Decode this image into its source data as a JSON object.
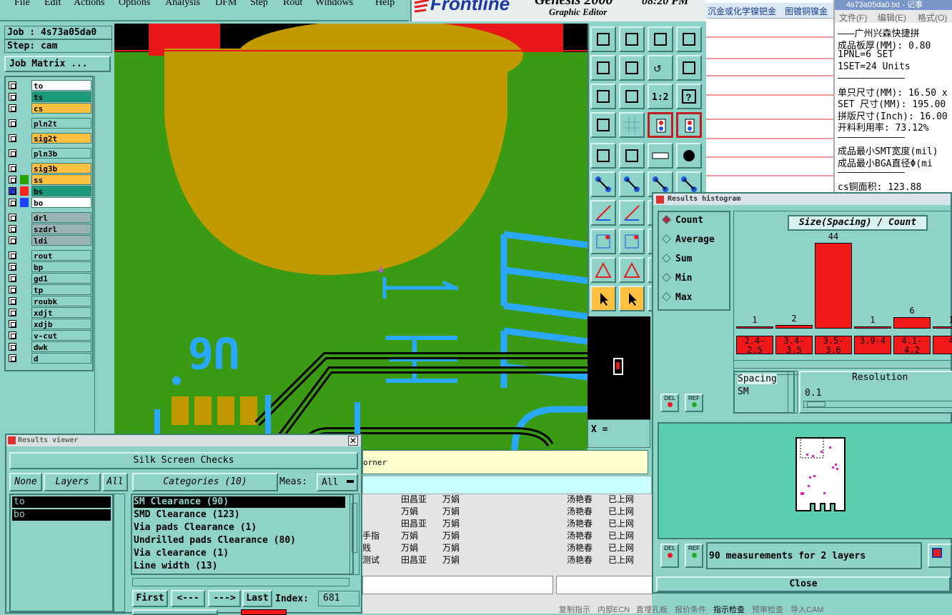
{
  "menubar": {
    "file": "File",
    "edit": "Edit",
    "actions": "Actions",
    "options": "Options",
    "analysis": "Analysis",
    "dfm": "DFM",
    "step": "Step",
    "rout": "Rout",
    "windows": "Windows",
    "help": "Help"
  },
  "logo": {
    "brand": "Frontline",
    "product": "Genesis 2000",
    "subtitle": "Graphic Editor",
    "time": "08:20 PM"
  },
  "job": {
    "job": "Job : 4s73a05da0",
    "step": "Step: cam",
    "matrix_btn": "Job Matrix ..."
  },
  "layers": [
    {
      "name": "to",
      "color": "#ffffff",
      "sw": ""
    },
    {
      "name": "ts",
      "color": "#1a9a7a",
      "sw": ""
    },
    {
      "name": "cs",
      "color": "#ffc040",
      "sw": ""
    },
    {
      "name": "pln2t",
      "color": "#8fd3c8",
      "sw": ""
    },
    {
      "name": "sig2t",
      "color": "#ffc040",
      "sw": ""
    },
    {
      "name": "pln3b",
      "color": "#8fd3c8",
      "sw": ""
    },
    {
      "name": "sig3b",
      "color": "#ffc040",
      "sw": ""
    },
    {
      "name": "ss",
      "color": "#ffc040",
      "sw": "#2aa000"
    },
    {
      "name": "bs",
      "color": "#1a9a7a",
      "sw": "#ff2020"
    },
    {
      "name": "bo",
      "color": "#ffffff",
      "sw": "#2040ff"
    },
    {
      "name": "drl",
      "color": "#9ab4b4",
      "sw": ""
    },
    {
      "name": "szdrl",
      "color": "#9ab4b4",
      "sw": ""
    },
    {
      "name": "ldi",
      "color": "#9ab4b4",
      "sw": ""
    },
    {
      "name": "rout",
      "color": "#8fd3c8",
      "sw": ""
    },
    {
      "name": "bp",
      "color": "#8fd3c8",
      "sw": ""
    },
    {
      "name": "gd1",
      "color": "#8fd3c8",
      "sw": ""
    },
    {
      "name": "tp",
      "color": "#8fd3c8",
      "sw": ""
    },
    {
      "name": "roubk",
      "color": "#8fd3c8",
      "sw": ""
    },
    {
      "name": "xdjt",
      "color": "#8fd3c8",
      "sw": ""
    },
    {
      "name": "xdjb",
      "color": "#8fd3c8",
      "sw": ""
    },
    {
      "name": "v-cut",
      "color": "#8fd3c8",
      "sw": ""
    },
    {
      "name": "dwk",
      "color": "#8fd3c8",
      "sw": ""
    },
    {
      "name": "d",
      "color": "#8fd3c8",
      "sw": ""
    }
  ],
  "pcb": {
    "silk_text": "U6"
  },
  "status": {
    "x_label": "X =",
    "msg": "orner"
  },
  "results_viewer": {
    "title": "Results viewer",
    "header": "Silk Screen Checks",
    "none": "None",
    "layers": "Layers",
    "all": "All",
    "categories": "Categories (10)",
    "meas_label": "Meas:",
    "meas_value": "All",
    "layer_list": [
      "to",
      "bo"
    ],
    "checks": [
      "SM Clearance (90)",
      "SMD Clearance (123)",
      "Via pads Clearance (1)",
      "Undrilled pads Clearance (80)",
      "Via clearance (1)",
      "Line width (13)"
    ],
    "first": "First",
    "prev": "<---",
    "next": "--->",
    "last": "Last",
    "index_label": "Index:",
    "index_value": "681"
  },
  "histogram": {
    "title": "Results histogram",
    "modes": [
      "Count",
      "Average",
      "Sum",
      "Min",
      "Max"
    ],
    "chart_title": "Size(Spacing) / Count",
    "spacing_label": "Spacing",
    "sm_label": "SM",
    "resolution_label": "Resolution",
    "resolution_value": "0.1",
    "del": "DEL",
    "ref": "REF",
    "summary": "90 measurements for 2 layers",
    "close": "Close"
  },
  "chart_data": {
    "type": "bar",
    "title": "Size(Spacing) / Count",
    "categories": [
      "2.4-2.5",
      "3.4-3.5",
      "3.5-3.6",
      "3.9-4",
      "4.1-4.2",
      "4"
    ],
    "values": [
      1,
      2,
      44,
      1,
      6,
      1
    ]
  },
  "tabs_cn": {
    "t1": "沉金或化学镍钯金",
    "t2": "图镀铜镍金"
  },
  "notepad": {
    "title": "4s73a05da0.txt - 记事",
    "menu": [
      "文件(F)",
      "编辑(E)",
      "格式(O)"
    ],
    "lines": [
      "———广州兴森快捷拼",
      "成品板厚(MM): 0.80",
      "1PNL=6 SET",
      "1SET=24 Units",
      "————————————",
      "单只尺寸(MM): 16.50 x",
      "SET 尺寸(MM): 195.00",
      "拼版尺寸(Inch): 16.00",
      "开料利用率: 73.12%",
      "————————————",
      "成品最小SMT宽度(mil)",
      "成品最小BGA直径Φ(mi",
      "————————————",
      "cs铜面积: 123.88",
      "   铜面积: 124.17"
    ]
  },
  "table_cn": [
    [
      "",
      "田昌亚",
      "万娟",
      "汤艳春",
      "已上网"
    ],
    [
      "",
      "万娟",
      "万娟",
      "汤艳春",
      "已上网"
    ],
    [
      "",
      "田昌亚",
      "万娟",
      "汤艳春",
      "已上网"
    ],
    [
      "手指",
      "万娟",
      "万娟",
      "汤艳春",
      "已上网"
    ],
    [
      "贱",
      "万娟",
      "万娟",
      "汤艳春",
      "已上网"
    ],
    [
      "测试",
      "田昌亚",
      "万娟",
      "汤艳春",
      "已上网"
    ]
  ],
  "bottom_tabs": [
    "复制指示",
    "内部ECN",
    "直埋孔板",
    "报价条件",
    "指示检查",
    "预审检查",
    "导入CAM"
  ]
}
